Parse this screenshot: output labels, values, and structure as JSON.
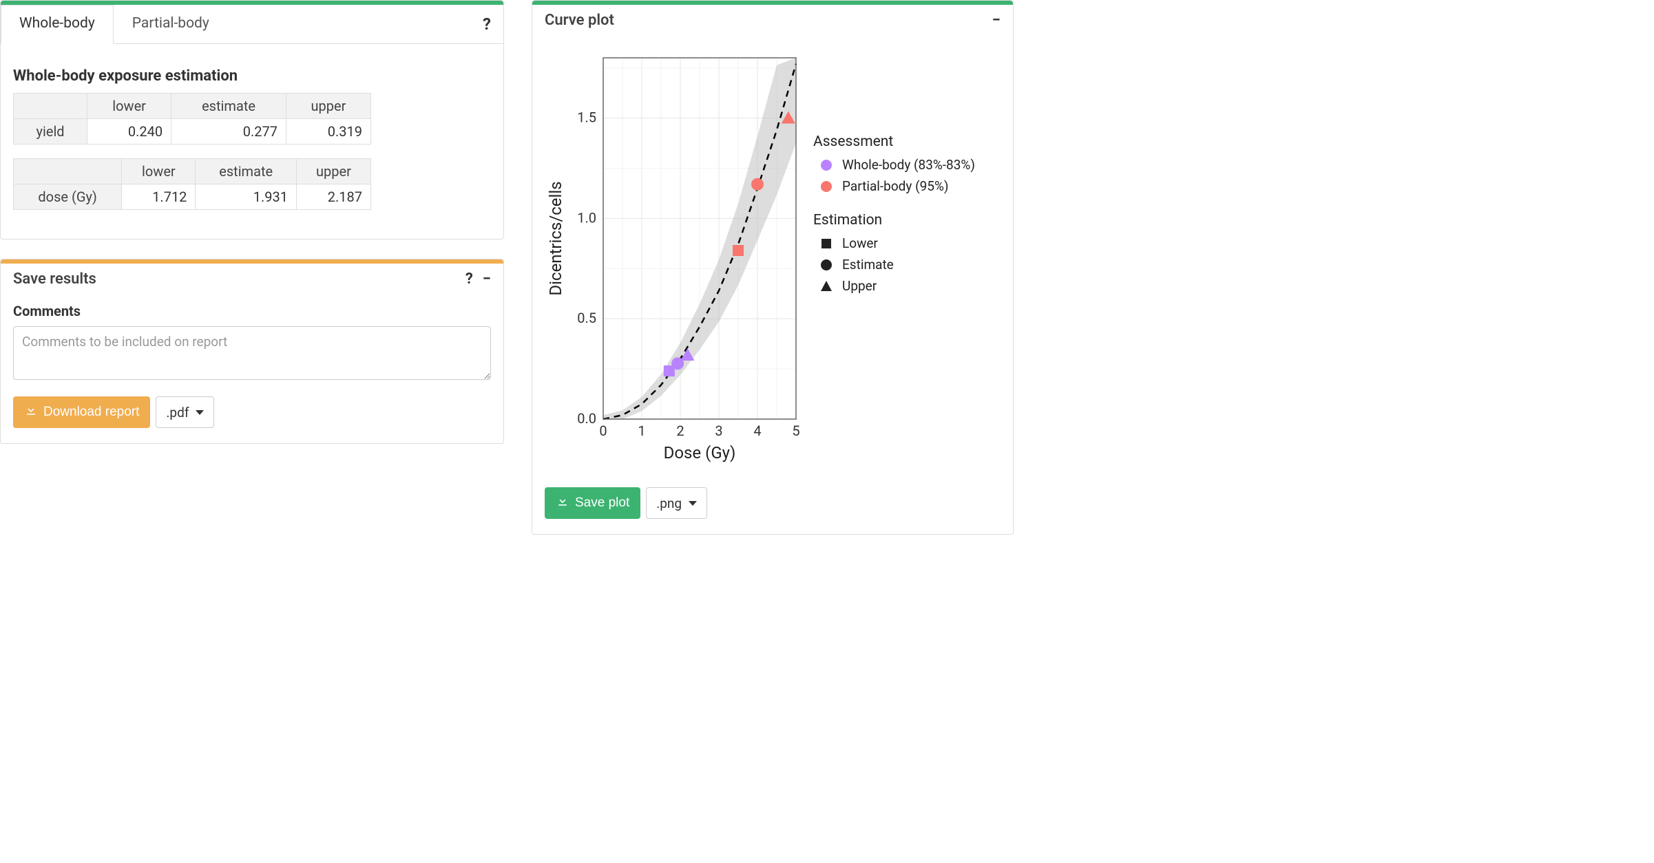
{
  "tabs": {
    "whole": "Whole-body",
    "partial": "Partial-body"
  },
  "estimation": {
    "title": "Whole-body exposure estimation",
    "col_lower": "lower",
    "col_estimate": "estimate",
    "col_upper": "upper",
    "yield_label": "yield",
    "yield_lower": "0.240",
    "yield_estimate": "0.277",
    "yield_upper": "0.319",
    "dose_label": "dose (Gy)",
    "dose_lower": "1.712",
    "dose_estimate": "1.931",
    "dose_upper": "2.187"
  },
  "save_results": {
    "title": "Save results",
    "comments_label": "Comments",
    "comments_placeholder": "Comments to be included on report",
    "download_label": "Download report",
    "format": ".pdf"
  },
  "curve_plot": {
    "title": "Curve plot",
    "save_label": "Save plot",
    "format": ".png",
    "ylabel": "Dicentrics/cells",
    "xlabel": "Dose (Gy)",
    "legend_assessment_title": "Assessment",
    "legend_whole": "Whole-body (83%-83%)",
    "legend_partial": "Partial-body (95%)",
    "legend_estimation_title": "Estimation",
    "legend_lower": "Lower",
    "legend_estimate": "Estimate",
    "legend_upper": "Upper"
  },
  "colors": {
    "green": "#3CB371",
    "orange": "#f0ad4e",
    "purple": "#B983FF",
    "salmon": "#F8766D"
  },
  "chart_data": {
    "type": "scatter",
    "title": "Curve plot",
    "xlabel": "Dose (Gy)",
    "ylabel": "Dicentrics/cells",
    "xlim": [
      0,
      5
    ],
    "ylim": [
      0,
      1.8
    ],
    "xticks": [
      0,
      1,
      2,
      3,
      4,
      5
    ],
    "yticks": [
      0.0,
      0.5,
      1.0,
      1.5
    ],
    "curve": {
      "x": [
        0,
        0.5,
        1,
        1.5,
        2,
        2.5,
        3,
        3.5,
        4,
        4.5,
        5
      ],
      "y": [
        0.0,
        0.02,
        0.075,
        0.17,
        0.3,
        0.46,
        0.64,
        0.87,
        1.15,
        1.44,
        1.77
      ],
      "confidence_band": true
    },
    "series": [
      {
        "name": "Whole-body (83%-83%)",
        "color": "#B983FF",
        "points": [
          {
            "estimation": "Lower",
            "shape": "square",
            "x": 1.712,
            "y": 0.24
          },
          {
            "estimation": "Estimate",
            "shape": "circle",
            "x": 1.931,
            "y": 0.277
          },
          {
            "estimation": "Upper",
            "shape": "triangle",
            "x": 2.187,
            "y": 0.319
          }
        ]
      },
      {
        "name": "Partial-body (95%)",
        "color": "#F8766D",
        "points": [
          {
            "estimation": "Lower",
            "shape": "square",
            "x": 3.5,
            "y": 0.84
          },
          {
            "estimation": "Estimate",
            "shape": "circle",
            "x": 4.0,
            "y": 1.17
          },
          {
            "estimation": "Upper",
            "shape": "triangle",
            "x": 4.8,
            "y": 1.5
          }
        ]
      }
    ]
  }
}
